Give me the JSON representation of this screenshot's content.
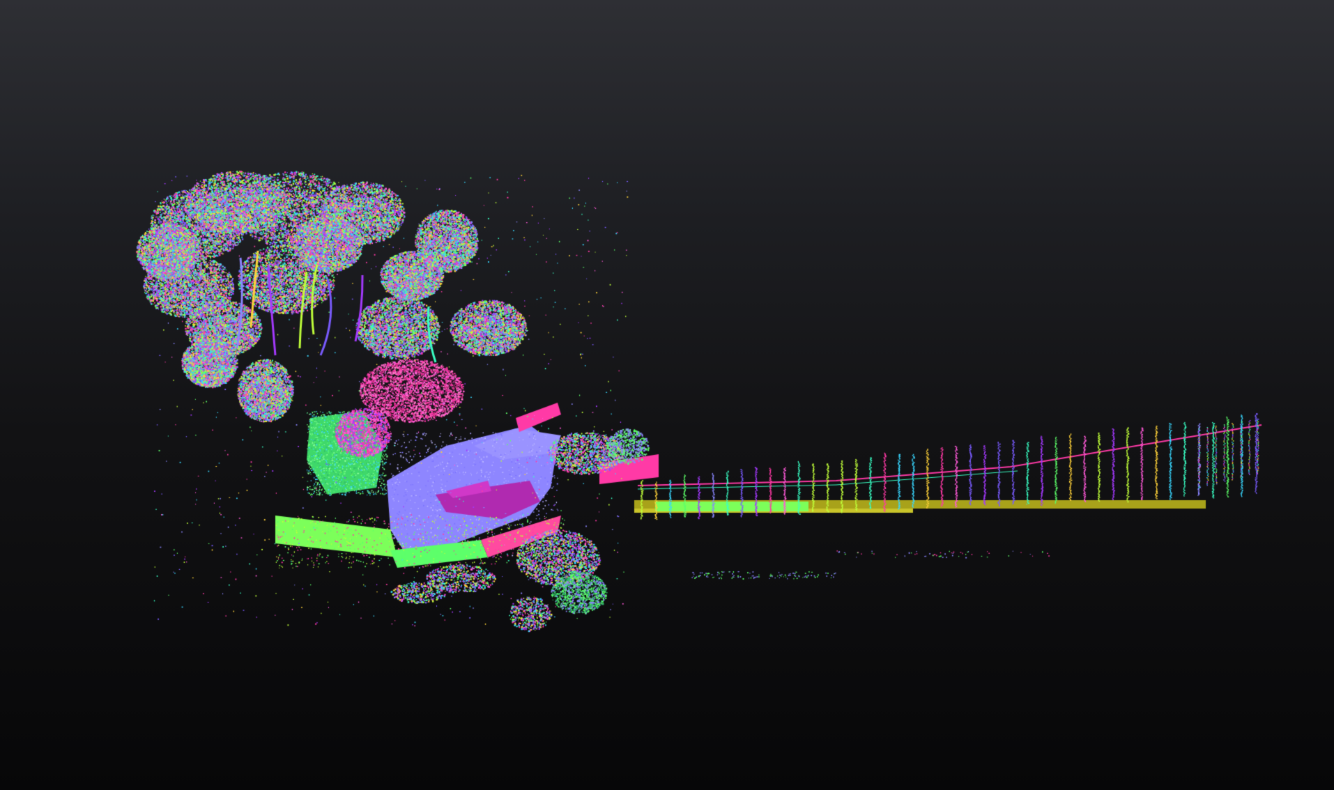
{
  "scene": {
    "colors": {
      "background_top": "#2e2f34",
      "background_bottom": "#070708",
      "normal_x": "#ff3aa6",
      "normal_y": "#5dff6a",
      "normal_z": "#8a86ff"
    }
  }
}
